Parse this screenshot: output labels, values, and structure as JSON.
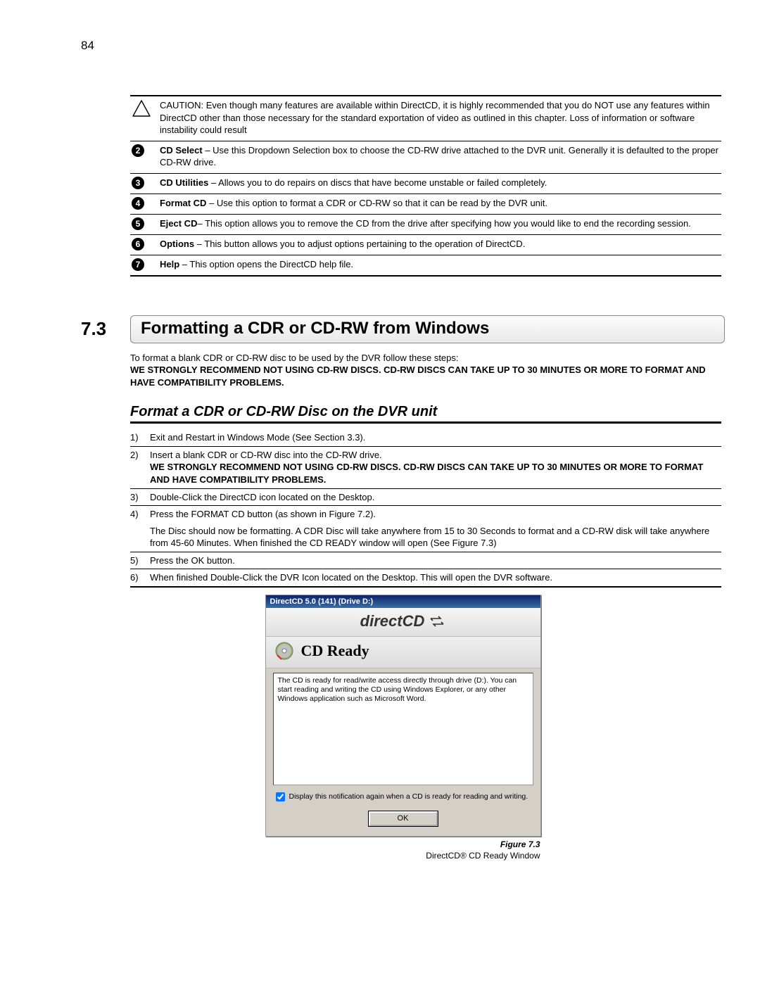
{
  "page_number": "84",
  "top_rows": [
    {
      "type": "caution",
      "caption": "CAUTION:",
      "text": "Even though many features are available within DirectCD, it is highly recommended that you do NOT use any features within DirectCD other than those necessary for the standard exportation of video as outlined in this chapter. Loss of information or software instability could result"
    },
    {
      "num": "2",
      "bold": "CD Select",
      "text": " – Use this Dropdown Selection box to choose the CD-RW drive attached to the DVR unit. Generally it is defaulted to the proper CD-RW drive."
    },
    {
      "num": "3",
      "bold": "CD Utilities",
      "text": " – Allows you to do repairs on discs that have become unstable or failed completely."
    },
    {
      "num": "4",
      "bold": "Format CD",
      "text": " – Use this option to format a CDR or CD-RW so that it can be read by the DVR unit."
    },
    {
      "num": "5",
      "bold": "Eject CD",
      "text": "– This option allows you to remove the CD from the drive after specifying how you would like to end the recording session."
    },
    {
      "num": "6",
      "bold": "Options",
      "text": " – This button allows you to adjust options pertaining to the operation of DirectCD."
    },
    {
      "num": "7",
      "bold": "Help",
      "text": " – This option opens the DirectCD help file."
    }
  ],
  "section": {
    "number": "7.3",
    "title": "Formatting a CDR or CD-RW from Windows",
    "intro": "To format a blank CDR or CD-RW disc to be used by the DVR follow these steps:",
    "intro_bold": "WE STRONGLY RECOMMEND NOT USING CD-RW DISCS. CD-RW DISCS CAN TAKE UP TO 30 MINUTES OR MORE TO FORMAT AND HAVE COMPATIBILITY PROBLEMS."
  },
  "subheading": "Format a CDR or CD-RW Disc on the DVR unit",
  "steps": [
    {
      "n": "1)",
      "text": "Exit and Restart in Windows Mode (See Section 3.3)."
    },
    {
      "n": "2)",
      "text": "Insert a blank CDR or CD-RW disc into the CD-RW drive.",
      "bold_extra": "WE STRONGLY RECOMMEND NOT USING CD-RW DISCS. CD-RW DISCS CAN TAKE UP TO 30 MINUTES OR MORE TO FORMAT AND HAVE COMPATIBILITY PROBLEMS."
    },
    {
      "n": "3)",
      "text": "Double-Click the DirectCD icon located on the Desktop."
    },
    {
      "n": "4)",
      "text": "Press the FORMAT CD button (as shown in Figure 7.2).",
      "extra": "The Disc should now be formatting. A CDR Disc will take anywhere from 15 to 30 Seconds to format and a CD-RW disk will take anywhere from 45-60 Minutes. When finished the CD READY window will open (See Figure 7.3)"
    },
    {
      "n": "5)",
      "text": "Press the OK button."
    },
    {
      "n": "6)",
      "text": "When finished Double-Click the DVR Icon located on the Desktop. This will open the DVR software."
    }
  ],
  "window": {
    "title": "DirectCD 5.0 (141) (Drive D:)",
    "brand": "directCD",
    "ready": "CD Ready",
    "body": "The CD is ready for read/write access directly through drive (D:). You can start reading and writing the CD using Windows Explorer, or any other Windows application such as Microsoft Word.",
    "checkbox_label": "Display this notification again when a CD is ready for reading and writing.",
    "ok": "OK"
  },
  "figure": {
    "label": "Figure 7.3",
    "caption": "DirectCD® CD Ready Window"
  }
}
